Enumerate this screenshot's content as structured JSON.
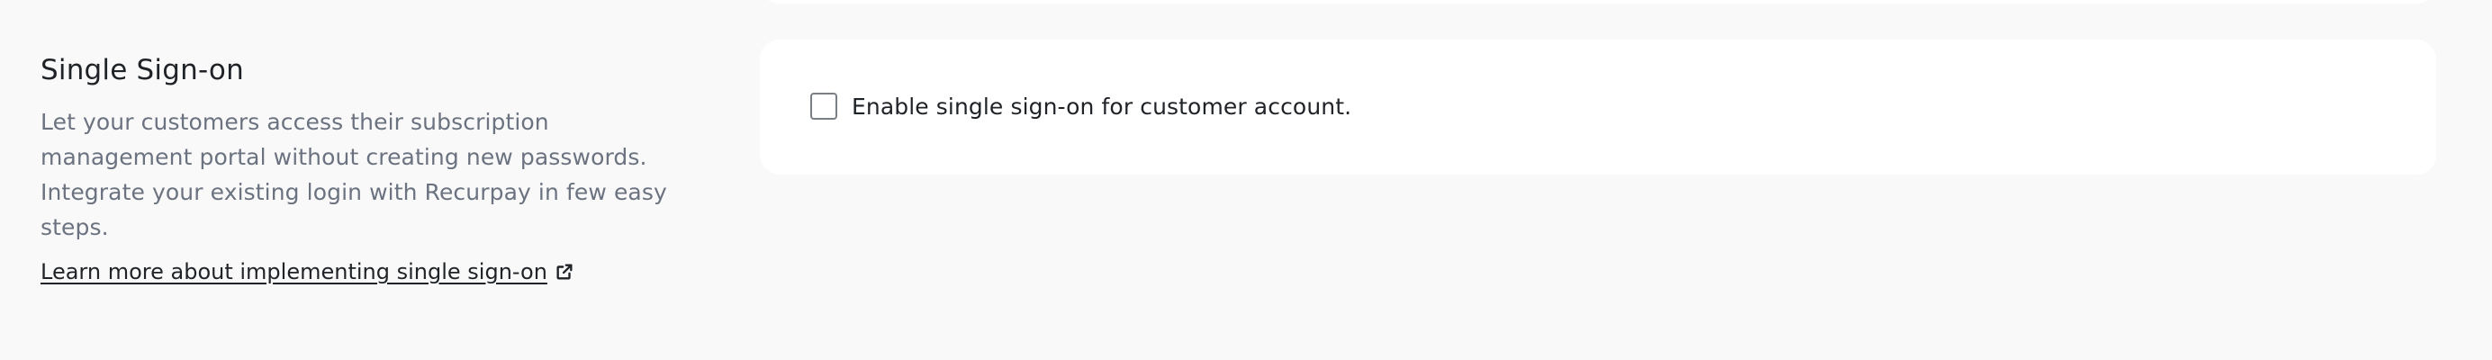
{
  "section": {
    "title": "Single Sign-on",
    "description": "Let your customers access their subscription management portal without creating new passwords. Integrate your existing login with Recurpay in few easy steps.",
    "learn_more_label": "Learn more about implementing single sign-on",
    "learn_more_icon": "external-link-icon"
  },
  "card": {
    "checkbox_label": "Enable single sign-on for customer account.",
    "checked": false
  }
}
